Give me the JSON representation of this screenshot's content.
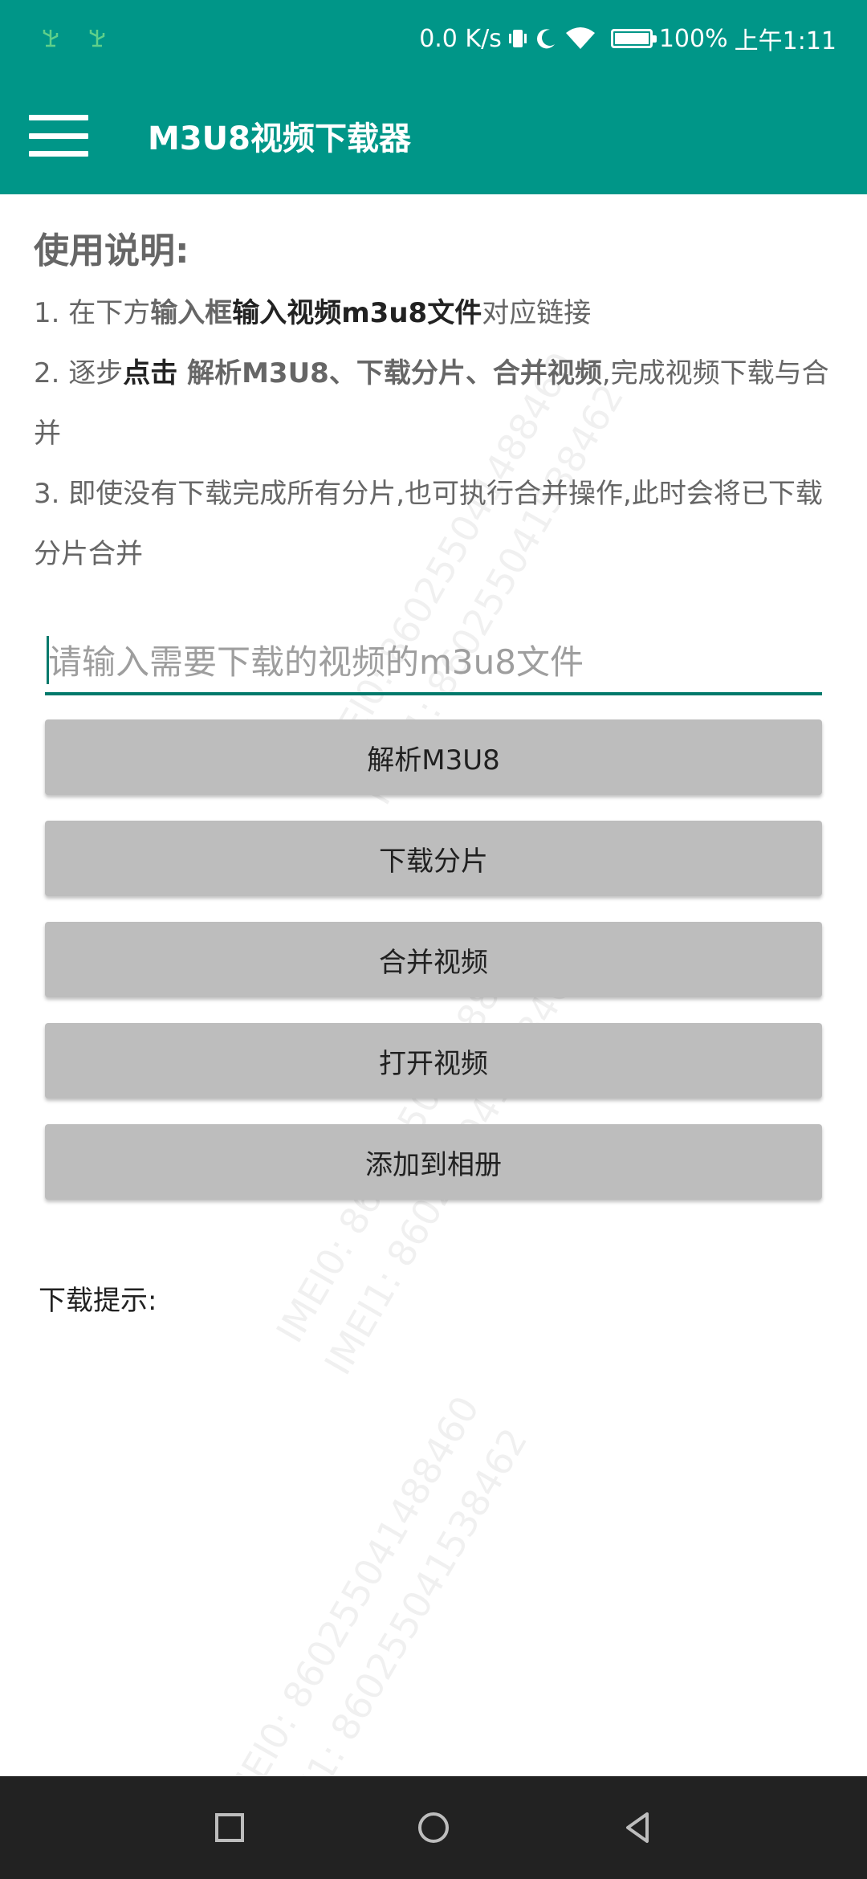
{
  "status_bar": {
    "speed": "0.0 K/s",
    "battery": "100%",
    "time": "上午1:11"
  },
  "app_bar": {
    "title": "M3U8视频下载器"
  },
  "instructions": {
    "heading": "使用说明:",
    "line1": {
      "prefix": "1. 在下方",
      "bold1": "输入框",
      "bold2": "输入视频m3u8文件",
      "suffix": "对应链接"
    },
    "line2": {
      "prefix": "2. 逐步",
      "bold1": "点击",
      "bold2": " 解析M3U8、下载分片、合并视频",
      "suffix": ",完成视频下载与合并"
    },
    "line3": "3. 即使没有下载完成所有分片,也可执行合并操作,此时会将已下载分片合并"
  },
  "url_input": {
    "placeholder": "请输入需要下载的视频的m3u8文件",
    "value": ""
  },
  "buttons": {
    "parse": "解析M3U8",
    "download": "下载分片",
    "merge": "合并视频",
    "open": "打开视频",
    "add_album": "添加到相册"
  },
  "download_hint": "下载提示:",
  "watermark": {
    "imei0": "IMEI0: 860255041488460",
    "imei1": "IMEI1: 860255041538462"
  }
}
